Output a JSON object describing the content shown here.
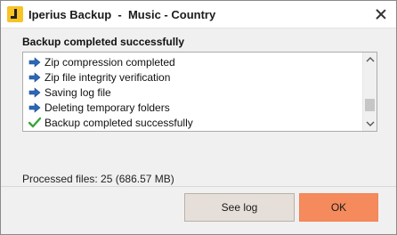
{
  "window": {
    "title": "Iperius Backup  -  Music - Country",
    "app_icon": "iperius-logo-icon",
    "close_icon": "close-icon"
  },
  "dialog": {
    "heading": "Backup completed successfully",
    "log": {
      "items": [
        {
          "icon": "arrow-right-icon",
          "text": "Zip compression completed"
        },
        {
          "icon": "arrow-right-icon",
          "text": "Zip file integrity verification"
        },
        {
          "icon": "arrow-right-icon",
          "text": "Saving log file"
        },
        {
          "icon": "arrow-right-icon",
          "text": "Deleting temporary folders"
        },
        {
          "icon": "check-icon",
          "text": "Backup completed successfully"
        }
      ]
    },
    "processed_files": "Processed files: 25 (686.57 MB)",
    "buttons": {
      "see_log": "See log",
      "ok": "OK"
    }
  },
  "colors": {
    "ok_button": "#f58a5c",
    "see_log_button": "#e6dfd9",
    "arrow": "#2c68b8",
    "check": "#3aa43a"
  }
}
